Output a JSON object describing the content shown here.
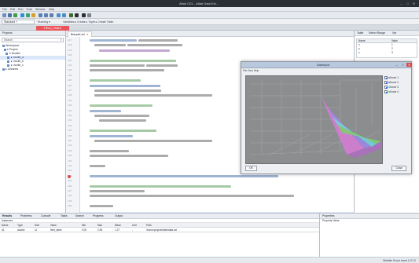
{
  "window": {
    "title": "Altair CEL - Altair Data Ext...",
    "min": "–",
    "max": "□",
    "close": "✕"
  },
  "menu": [
    "File",
    "Edit",
    "Run",
    "Tools",
    "Window",
    "Help"
  ],
  "toolbar2": {
    "project": "Standard   +",
    "field_label": "Running ▾",
    "breadcrumb": "Variables  ▸  Create  ▸  Tuple  ▸  Create Table"
  },
  "main_tab": "FIELD_TABLE",
  "left_panel": {
    "title": "Projects",
    "search_placeholder": "Search",
    "tree": [
      "Workspace",
      "▾ Project",
      "  ▾ Models",
      "    ▸ model_a",
      "    ▸ model_b",
      "    ▸ model_c",
      "▸ Libraries"
    ]
  },
  "editor": {
    "tab": "Beispiel.cel",
    "line_numbers": [
      "117",
      "118",
      "119",
      "120",
      "121",
      "122",
      "123",
      "124",
      "125",
      "126",
      "127",
      "128",
      "129",
      "130",
      "131",
      "132",
      "133",
      "134",
      "135",
      "136",
      "137",
      "138",
      "139",
      "140",
      "141",
      "142",
      "143",
      "144",
      "145",
      "146",
      "147",
      "148",
      "149",
      "150"
    ]
  },
  "right_panel": {
    "tabs": [
      "Table",
      "Select Range",
      "Var"
    ],
    "table_header": [
      "Name",
      "Value"
    ],
    "rows": [
      [
        "x",
        "1"
      ],
      [
        "y",
        "2"
      ],
      [
        "z",
        "3"
      ]
    ]
  },
  "popup": {
    "title": "Datenplot",
    "min": "–",
    "max": "□",
    "close": "✕",
    "menu": "File  View  Help",
    "legend": [
      "Kurve 1",
      "Kurve 2",
      "Kurve 3",
      "Kurve 4"
    ],
    "ok": "OK",
    "cancel": "Close",
    "colors": {
      "magenta": "#d77bd6",
      "cyan": "#6fd2df",
      "green": "#7bd36a",
      "violet": "#9b87e6"
    }
  },
  "bottom": {
    "tabs": [
      "Results",
      "Problems",
      "Console",
      "Tasks",
      "Search",
      "Progress",
      "Output"
    ],
    "sub": "Instances",
    "columns": [
      "Name",
      "Type",
      "Size",
      "Value",
      "Min",
      "Max",
      "Mean",
      "Unit",
      "Path"
    ],
    "row": [
      "d1",
      "double",
      "11",
      "field_table",
      "0.00",
      "2.55",
      "1.27",
      "-",
      "/home/project/table/data.cel"
    ]
  },
  "bottom_right": {
    "title": "Properties",
    "sub": "Property   Value"
  },
  "status": "Writable   Smart Insert   147:12"
}
